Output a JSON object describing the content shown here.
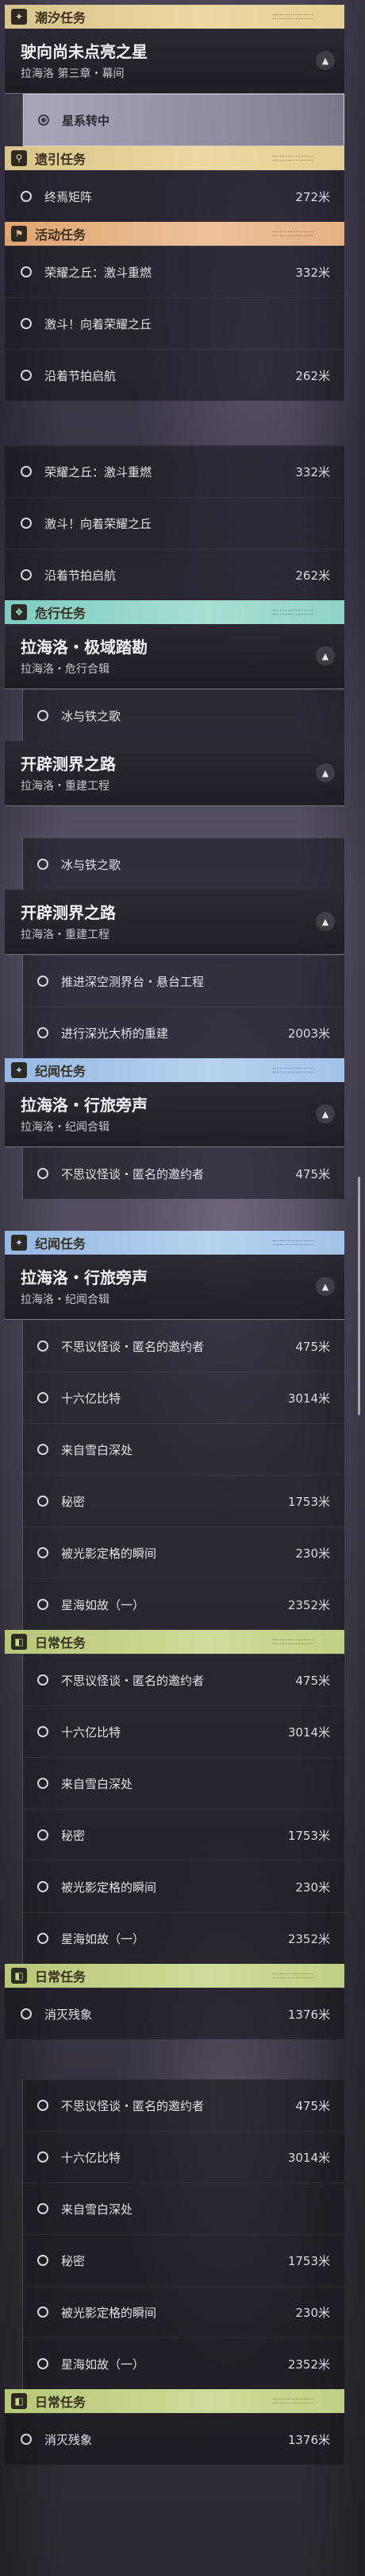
{
  "panels": [
    {
      "type": "cat",
      "color": "gold",
      "icon": "✦",
      "icon_name": "star-icon",
      "label": "潮汐任务"
    },
    {
      "type": "grp",
      "title": "驶向尚未点亮之星",
      "subtitle": "拉海洛 第三章・幕间"
    },
    {
      "type": "rows",
      "sub": true,
      "rows": [
        {
          "name": "星系转中",
          "dist": "",
          "selected": true
        }
      ]
    },
    {
      "type": "cat",
      "color": "gold",
      "icon": "⚲",
      "icon_name": "map-pin-icon",
      "label": "遗引任务"
    },
    {
      "type": "rows",
      "rows": [
        {
          "name": "终焉矩阵",
          "dist": "272米"
        }
      ]
    },
    {
      "type": "cat",
      "color": "orange",
      "icon": "⚑",
      "icon_name": "flag-icon",
      "label": "活动任务"
    },
    {
      "type": "rows",
      "rows": [
        {
          "name": "荣耀之丘：激斗重燃",
          "dist": "332米"
        },
        {
          "name": "激斗！向着荣耀之丘",
          "dist": ""
        },
        {
          "name": "沿着节拍启航",
          "dist": "262米"
        }
      ]
    },
    {
      "type": "gap",
      "h": 56
    },
    {
      "type": "rows",
      "rows": [
        {
          "name": "荣耀之丘：激斗重燃",
          "dist": "332米"
        },
        {
          "name": "激斗！向着荣耀之丘",
          "dist": ""
        },
        {
          "name": "沿着节拍启航",
          "dist": "262米"
        }
      ]
    },
    {
      "type": "cat",
      "color": "teal",
      "icon": "❖",
      "icon_name": "danger-icon",
      "label": "危行任务"
    },
    {
      "type": "grp",
      "title": "拉海洛・极域踏勘",
      "subtitle": "拉海洛・危行合辑"
    },
    {
      "type": "rows",
      "sub": true,
      "rows": [
        {
          "name": "冰与铁之歌",
          "dist": ""
        }
      ]
    },
    {
      "type": "grp",
      "title": "开辟测界之路",
      "subtitle": "拉海洛・重建工程"
    },
    {
      "type": "gap",
      "h": 40
    },
    {
      "type": "rows",
      "sub": true,
      "rows": [
        {
          "name": "冰与铁之歌",
          "dist": ""
        }
      ]
    },
    {
      "type": "grp",
      "title": "开辟测界之路",
      "subtitle": "拉海洛・重建工程"
    },
    {
      "type": "rows",
      "sub": true,
      "rows": [
        {
          "name": "推进深空测界台・悬台工程",
          "dist": ""
        },
        {
          "name": "进行深光大桥的重建",
          "dist": "2003米"
        }
      ]
    },
    {
      "type": "cat",
      "color": "blue",
      "icon": "✦",
      "icon_name": "sparkle-icon",
      "label": "纪闻任务"
    },
    {
      "type": "grp",
      "title": "拉海洛・行旅旁声",
      "subtitle": "拉海洛・纪闻合辑"
    },
    {
      "type": "rows",
      "sub": true,
      "rows": [
        {
          "name": "不思议怪谈・匿名的邀约者",
          "dist": "475米"
        }
      ]
    },
    {
      "type": "gap",
      "h": 40
    },
    {
      "type": "cat",
      "color": "blue",
      "icon": "✦",
      "icon_name": "sparkle-icon",
      "label": "纪闻任务"
    },
    {
      "type": "grp",
      "title": "拉海洛・行旅旁声",
      "subtitle": "拉海洛・纪闻合辑"
    },
    {
      "type": "rows",
      "sub": true,
      "rows": [
        {
          "name": "不思议怪谈・匿名的邀约者",
          "dist": "475米"
        },
        {
          "name": "十六亿比特",
          "dist": "3014米"
        },
        {
          "name": "来自雪白深处",
          "dist": ""
        },
        {
          "name": "秘密",
          "dist": "1753米"
        },
        {
          "name": "被光影定格的瞬间",
          "dist": "230米"
        },
        {
          "name": "星海如故（一）",
          "dist": "2352米"
        }
      ]
    },
    {
      "type": "cat",
      "color": "green",
      "icon": "◧",
      "icon_name": "book-icon",
      "label": "日常任务"
    },
    {
      "type": "rows",
      "sub": true,
      "rows": [
        {
          "name": "不思议怪谈・匿名的邀约者",
          "dist": "475米"
        },
        {
          "name": "十六亿比特",
          "dist": "3014米"
        },
        {
          "name": "来自雪白深处",
          "dist": ""
        },
        {
          "name": "秘密",
          "dist": "1753米"
        },
        {
          "name": "被光影定格的瞬间",
          "dist": "230米"
        },
        {
          "name": "星海如故（一）",
          "dist": "2352米"
        }
      ]
    },
    {
      "type": "cat",
      "color": "green",
      "icon": "◧",
      "icon_name": "book-icon",
      "label": "日常任务"
    },
    {
      "type": "rows",
      "rows": [
        {
          "name": "消灭残象",
          "dist": "1376米"
        }
      ]
    },
    {
      "type": "gap",
      "h": 50
    },
    {
      "type": "rows",
      "sub": true,
      "rows": [
        {
          "name": "不思议怪谈・匿名的邀约者",
          "dist": "475米"
        },
        {
          "name": "十六亿比特",
          "dist": "3014米"
        },
        {
          "name": "来自雪白深处",
          "dist": ""
        },
        {
          "name": "秘密",
          "dist": "1753米"
        },
        {
          "name": "被光影定格的瞬间",
          "dist": "230米"
        },
        {
          "name": "星海如故（一）",
          "dist": "2352米"
        }
      ]
    },
    {
      "type": "cat",
      "color": "green",
      "icon": "◧",
      "icon_name": "book-icon",
      "label": "日常任务"
    },
    {
      "type": "rows",
      "rows": [
        {
          "name": "消灭残象",
          "dist": "1376米"
        }
      ]
    }
  ]
}
